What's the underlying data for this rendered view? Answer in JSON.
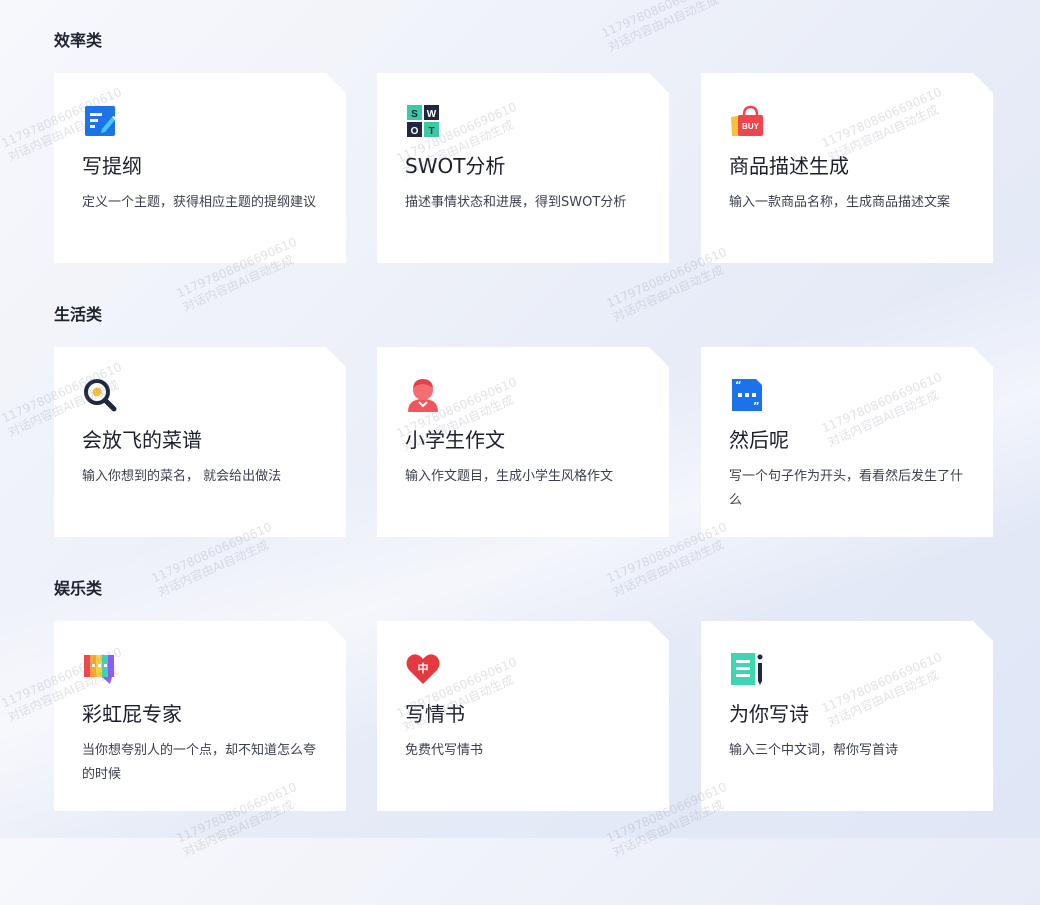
{
  "sections": [
    {
      "title": "效率类",
      "cards": [
        {
          "title": "写提纲",
          "desc": "定义一个主题，获得相应主题的提纲建议",
          "icon": "outline-icon"
        },
        {
          "title": "SWOT分析",
          "desc": "描述事情状态和进展，得到SWOT分析",
          "icon": "swot-icon"
        },
        {
          "title": "商品描述生成",
          "desc": "输入一款商品名称，生成商品描述文案",
          "icon": "shopping-bag-icon"
        }
      ]
    },
    {
      "title": "生活类",
      "cards": [
        {
          "title": "会放飞的菜谱",
          "desc": "输入你想到的菜名， 就会给出做法",
          "icon": "magnifier-icon"
        },
        {
          "title": "小学生作文",
          "desc": "输入作文题目，生成小学生风格作文",
          "icon": "student-icon"
        },
        {
          "title": "然后呢",
          "desc": "写一个句子作为开头，看看然后发生了什么",
          "icon": "quote-icon"
        }
      ]
    },
    {
      "title": "娱乐类",
      "cards": [
        {
          "title": "彩虹屁专家",
          "desc": "当你想夸别人的一个点，却不知道怎么夸的时候",
          "icon": "rainbow-chat-icon"
        },
        {
          "title": "写情书",
          "desc": "免费代写情书",
          "icon": "heart-icon"
        },
        {
          "title": "为你写诗",
          "desc": "输入三个中文词，帮你写首诗",
          "icon": "poem-icon"
        }
      ]
    }
  ],
  "icon_text": {
    "swot": [
      "S",
      "W",
      "O",
      "T"
    ],
    "buy": "BUY",
    "heart": "中"
  },
  "watermark": {
    "line1": "11797808606690610",
    "line2": "对话内容由AI自动生成"
  },
  "colors": {
    "blue": "#1a73e8",
    "red": "#f0464b",
    "orange": "#f9a33b",
    "teal": "#3dd6b3",
    "navy": "#20283f"
  }
}
